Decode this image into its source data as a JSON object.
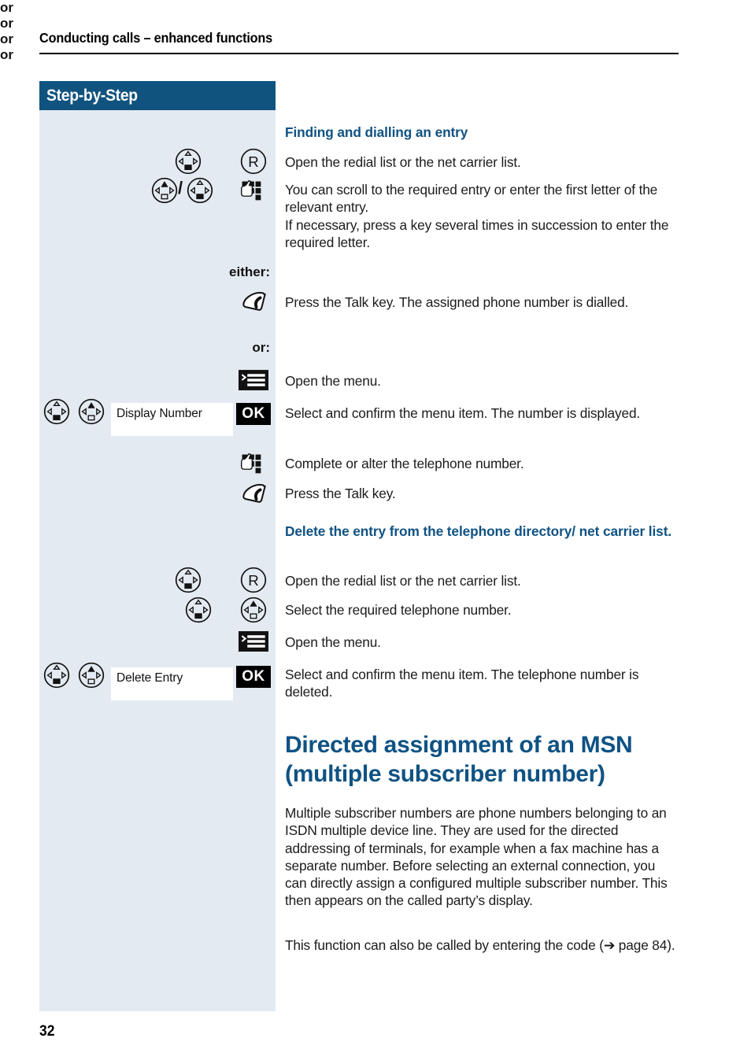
{
  "running_head": "Conducting calls – enhanced functions",
  "sidebar": {
    "header_label": "Step-by-Step",
    "labels": {
      "either": "either:",
      "or": "or:",
      "or_inline": "or",
      "slash": "/"
    },
    "menu_items": [
      {
        "label": "Display Number",
        "confirm_key": "OK"
      },
      {
        "label": "Delete Entry",
        "confirm_key": "OK"
      }
    ],
    "icons": [
      "nav-key-down-icon",
      "r-key-icon",
      "nav-key-up-icon",
      "keypad-icon",
      "talk-key-icon",
      "menu-key-icon"
    ]
  },
  "main": {
    "section_1": {
      "heading": "Finding and dialling an entry",
      "steps": [
        "Open the redial list or the net carrier list.",
        "You can scroll to the required entry or enter the first letter of the relevant entry.\nIf necessary, press a key several times in succession to enter the required letter.",
        "Press the Talk key. The assigned phone number is dialled.",
        "Open the menu.",
        "Select and confirm the menu item. The number is displayed.",
        "Complete or alter the telephone number.",
        "Press the Talk key."
      ]
    },
    "section_2": {
      "heading": "Delete the entry from the telephone directory/ net carrier list.",
      "steps": [
        "Open the redial list or the net carrier list.",
        "Select the required telephone number.",
        "Open the menu.",
        "Select and confirm the menu item. The telephone number is deleted."
      ]
    },
    "section_3": {
      "heading": "Directed assignment of an MSN (multiple subscriber number)",
      "paragraphs": [
        "Multiple subscriber numbers are phone numbers belonging to an ISDN multiple device line. They are used for the directed addressing of terminals, for example when a fax machine has a separate number. Before selecting an external connection, you can directly assign a configured multiple subscriber number. This then appears on the called party’s display.",
        "This function can also be called by entering the code (➔ page 84)."
      ]
    }
  },
  "page_number": "32",
  "colors": {
    "brand_blue": "#0f5283",
    "sidebar_header": "#10537f",
    "sidebar_body": "#e4eaf1",
    "text": "#1b1b1b"
  }
}
